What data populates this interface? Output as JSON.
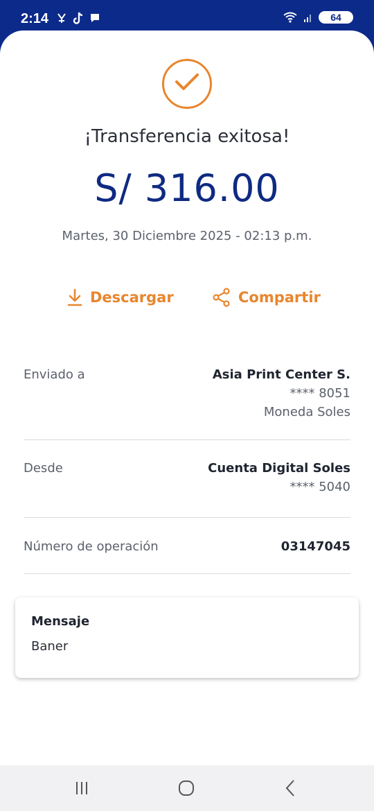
{
  "status_bar": {
    "time": "2:14",
    "battery": "64"
  },
  "receipt": {
    "title": "¡Transferencia exitosa!",
    "amount": "S/ 316.00",
    "datetime": "Martes, 30 Diciembre 2025 - 02:13 p.m.",
    "download_label": "Descargar",
    "share_label": "Compartir"
  },
  "details": {
    "sent_to": {
      "label": "Enviado a",
      "name": "Asia Print Center S.",
      "account": "**** 8051",
      "currency": "Moneda Soles"
    },
    "from": {
      "label": "Desde",
      "name": "Cuenta Digital Soles",
      "account": "**** 5040"
    },
    "operation": {
      "label": "Número de operación",
      "number": "03147045"
    }
  },
  "message": {
    "title": "Mensaje",
    "text": "Baner"
  },
  "colors": {
    "brand_blue": "#0b2a8a",
    "accent_orange": "#e8862e",
    "amount_blue": "#0f2a82"
  }
}
